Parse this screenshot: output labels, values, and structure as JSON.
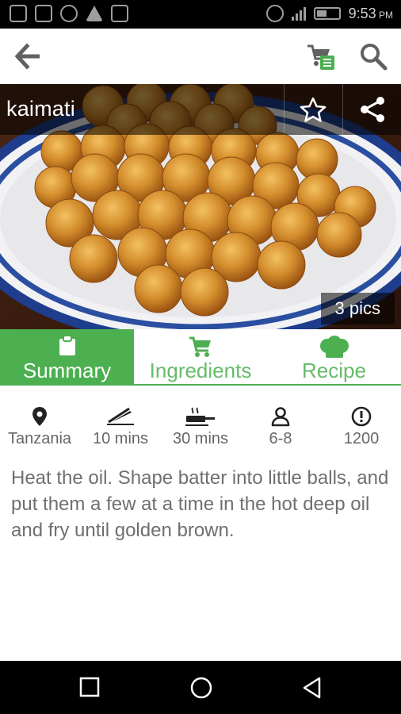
{
  "status_bar": {
    "time": "9:53",
    "ampm": "PM"
  },
  "app_bar": {
    "back_icon": "arrow-left-icon",
    "cart_icon": "shopping-list-icon",
    "search_icon": "search-icon",
    "accent": "#4caf50"
  },
  "recipe": {
    "title": "kaimati",
    "pics_label": "3 pics",
    "description": "Heat the oil. Shape batter into little balls, and put them a few at a time in the hot deep oil and fry until golden brown."
  },
  "tabs": [
    {
      "label": "Summary",
      "icon": "clipboard-icon",
      "active": true
    },
    {
      "label": "Ingredients",
      "icon": "cart-icon",
      "active": false
    },
    {
      "label": "Recipe",
      "icon": "chef-hat-icon",
      "active": false
    }
  ],
  "info": [
    {
      "label": "Tanzania",
      "icon": "location-pin-icon"
    },
    {
      "label": "10 mins",
      "icon": "knife-icon"
    },
    {
      "label": "30 mins",
      "icon": "cooking-pan-icon"
    },
    {
      "label": "6-8",
      "icon": "person-icon"
    },
    {
      "label": "1200",
      "icon": "alert-circle-icon"
    }
  ]
}
